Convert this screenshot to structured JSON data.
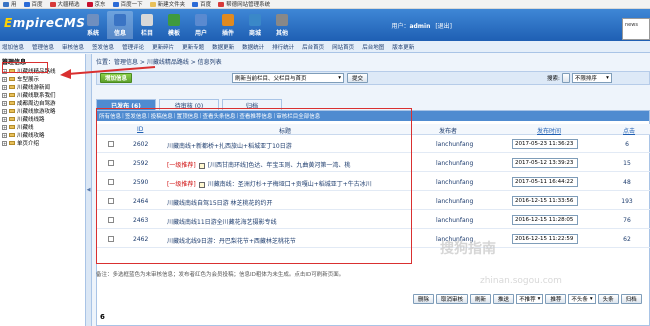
{
  "bookmarks": [
    "用",
    "百度",
    "大疆精选",
    "京东",
    "百度一下",
    "新建文件夹",
    "百度",
    "帮德网站管理系统"
  ],
  "header": {
    "logo": "EmpireCMS",
    "nav_tabs": [
      {
        "label": "系统",
        "icon": "system-icon",
        "color": "#6f8fbf"
      },
      {
        "label": "信息",
        "icon": "info-icon",
        "color": "#3a74c4"
      },
      {
        "label": "栏目",
        "icon": "column-icon",
        "color": "#d8d8d8"
      },
      {
        "label": "模板",
        "icon": "template-icon",
        "color": "#3f9a3f"
      },
      {
        "label": "用户",
        "icon": "user-icon",
        "color": "#5a8ad0"
      },
      {
        "label": "插件",
        "icon": "plugin-icon",
        "color": "#e08a20"
      },
      {
        "label": "商城",
        "icon": "shop-icon",
        "color": "#3a88c8"
      },
      {
        "label": "其他",
        "icon": "other-icon",
        "color": "#888888"
      }
    ],
    "user_label": "用户：",
    "username": "admin",
    "logout": "[退出]",
    "right_box_text": "news"
  },
  "subnav": [
    "增加信息",
    "管理信息",
    "审核信息",
    "签发信息",
    "管理评论",
    "更新碎片",
    "更新专题",
    "数据更新",
    "数据统计",
    "排行统计",
    "后台首页",
    "网站首页",
    "后台地图",
    "版本更新"
  ],
  "sidebar": {
    "title": "管理信息",
    "items": [
      "川藏线精品路线",
      "车型展示",
      "川藏线游新闻",
      "川藏线联系我们",
      "成都周边自驾游",
      "川藏线旅游攻略",
      "川藏线线路",
      "川藏线",
      "川藏线攻略",
      "单页介绍"
    ]
  },
  "breadcrumb": "位置：管理信息 > 川藏线精品路线 > 信息列表",
  "toolbar": {
    "add_button": "增加信息",
    "update_select": "刷新当前栏目、父栏目与首页",
    "submit": "提交",
    "search_label": "搜索:",
    "sort_select": "不限排序"
  },
  "tabs": [
    "已发布 (6)",
    "待审核 (0)",
    "归档"
  ],
  "filters": [
    "所有信息",
    "签发信息",
    "投稿信息",
    "置顶信息",
    "查看头条信息",
    "查看推荐信息",
    "审核栏目全部信息"
  ],
  "table": {
    "headers": {
      "id": "ID",
      "title": "标题",
      "publisher": "发布者",
      "date": "发布时间",
      "clicks": "点击"
    },
    "rows": [
      {
        "id": "2602",
        "tag": "",
        "title": "川藏南线+新都桥+扎西旅山+稻城亚丁10日游",
        "publisher": "lanchunfang",
        "date": "2017-05-23 11:36:23",
        "clicks": "6"
      },
      {
        "id": "2592",
        "tag": "[一级推荐]",
        "title": "[川西甘南环线]色达、年宝玉则、九曲黄河第一湾、桃",
        "publisher": "lanchunfang",
        "date": "2017-05-12 13:39:23",
        "clicks": "15"
      },
      {
        "id": "2590",
        "tag": "[一级推荐]",
        "title": "川藏南线：圣洲灯杉+子梅垭口+贡嘎山+稻城亚丁+牛古冰川",
        "publisher": "lanchunfang",
        "date": "2017-05-11 16:44:22",
        "clicks": "48"
      },
      {
        "id": "2464",
        "tag": "",
        "title": "川藏线南线自驾15日游 林芝桃花的约开",
        "publisher": "lanchunfang",
        "date": "2016-12-15 11:33:56",
        "clicks": "193"
      },
      {
        "id": "2463",
        "tag": "",
        "title": "川藏线南线11日游全川藏花海艺摄影专线",
        "publisher": "lanchunfang",
        "date": "2016-12-15 11:28:05",
        "clicks": "76"
      },
      {
        "id": "2462",
        "tag": "",
        "title": "川藏线北线9日游：丹巴梨花节+西藏林芝桃花节",
        "publisher": "lanchunfang",
        "date": "2016-12-15 11:22:59",
        "clicks": "62"
      }
    ]
  },
  "actions": [
    "删除",
    "取消审核",
    "刷新",
    "推送",
    "不推荐",
    "推荐",
    "不头条",
    "头条",
    "归档"
  ],
  "pager": "6",
  "note": "备注：多选框蓝色为未审核信息；发布者红色为会员投稿；信息ID粗体为未生成。点击ID可刷新页面。",
  "watermark": {
    "text": "搜狗指南",
    "url": "zhinan.sogou.com"
  },
  "colors": {
    "accent": "#4f8bd0",
    "header": "#1f5fb3",
    "annotation": "#d93030"
  }
}
